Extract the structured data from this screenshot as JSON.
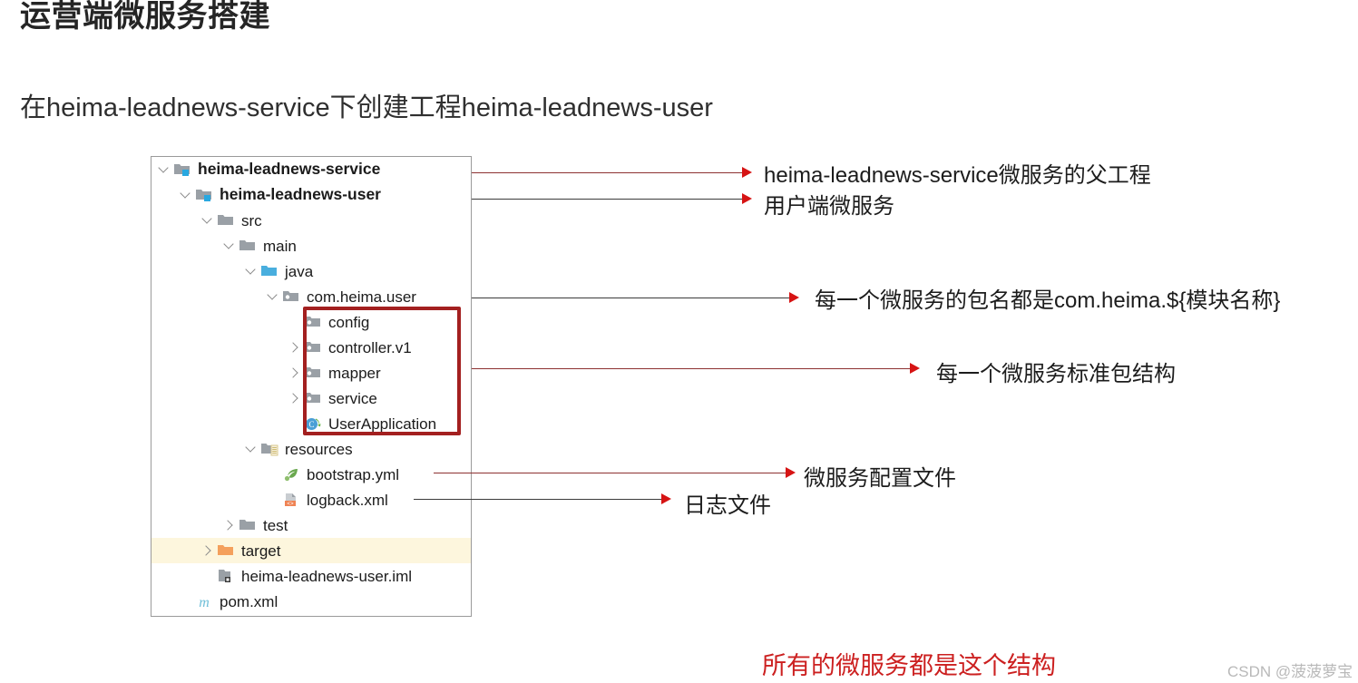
{
  "page": {
    "title": "运营端微服务搭建",
    "subtitle": "在heima-leadnews-service下创建工程heima-leadnews-user",
    "bottom_note": "所有的微服务都是这个结构",
    "watermark": "CSDN @菠菠萝宝"
  },
  "colors": {
    "red_box_border": "#a32020",
    "arrow_head": "#d61414",
    "arrow_line": "#8d3232",
    "arrow_line_dark": "#3b3b3b",
    "highlight_row": "#fdf6dd",
    "note_red": "#cc2020",
    "folder_gray": "#9aa0a6",
    "folder_blue": "#49aede",
    "folder_orange": "#f4a05c",
    "module_badge": "#29a8e0",
    "panel_border": "#9a9a9a"
  },
  "tree": {
    "rows": [
      {
        "label": "heima-leadnews-service",
        "icon": "module-folder-icon",
        "indent": 0,
        "chevron": "down",
        "bold": true,
        "highlight": false
      },
      {
        "label": "heima-leadnews-user",
        "icon": "module-folder-icon",
        "indent": 1,
        "chevron": "down",
        "bold": true,
        "highlight": false
      },
      {
        "label": "src",
        "icon": "folder-gray-icon",
        "indent": 2,
        "chevron": "down",
        "bold": false,
        "highlight": false
      },
      {
        "label": "main",
        "icon": "folder-gray-icon",
        "indent": 3,
        "chevron": "down",
        "bold": false,
        "highlight": false
      },
      {
        "label": "java",
        "icon": "folder-blue-icon",
        "indent": 4,
        "chevron": "down",
        "bold": false,
        "highlight": false
      },
      {
        "label": "com.heima.user",
        "icon": "package-icon",
        "indent": 5,
        "chevron": "down",
        "bold": false,
        "highlight": false
      },
      {
        "label": "config",
        "icon": "package-icon",
        "indent": 6,
        "chevron": "none",
        "bold": false,
        "highlight": false
      },
      {
        "label": "controller.v1",
        "icon": "package-icon",
        "indent": 6,
        "chevron": "right",
        "bold": false,
        "highlight": false
      },
      {
        "label": "mapper",
        "icon": "package-icon",
        "indent": 6,
        "chevron": "right",
        "bold": false,
        "highlight": false
      },
      {
        "label": "service",
        "icon": "package-icon",
        "indent": 6,
        "chevron": "right",
        "bold": false,
        "highlight": false
      },
      {
        "label": "UserApplication",
        "icon": "spring-class-icon",
        "indent": 6,
        "chevron": "none",
        "bold": false,
        "highlight": false
      },
      {
        "label": "resources",
        "icon": "resources-folder-icon",
        "indent": 4,
        "chevron": "down",
        "bold": false,
        "highlight": false
      },
      {
        "label": "bootstrap.yml",
        "icon": "yaml-leaf-icon",
        "indent": 5,
        "chevron": "none",
        "bold": false,
        "highlight": false
      },
      {
        "label": "logback.xml",
        "icon": "xml-file-icon",
        "indent": 5,
        "chevron": "none",
        "bold": false,
        "highlight": false
      },
      {
        "label": "test",
        "icon": "folder-gray-icon",
        "indent": 3,
        "chevron": "right",
        "bold": false,
        "highlight": false
      },
      {
        "label": "target",
        "icon": "folder-orange-icon",
        "indent": 2,
        "chevron": "right",
        "bold": false,
        "highlight": true
      },
      {
        "label": "heima-leadnews-user.iml",
        "icon": "iml-module-icon",
        "indent": 2,
        "chevron": "none",
        "bold": false,
        "highlight": false
      },
      {
        "label": "pom.xml",
        "icon": "maven-icon",
        "indent": 1,
        "chevron": "none",
        "bold": false,
        "highlight": false
      }
    ]
  },
  "annotations": [
    {
      "id": "a1",
      "text": "heima-leadnews-service微服务的父工程"
    },
    {
      "id": "a2",
      "text": "用户端微服务"
    },
    {
      "id": "a3",
      "text": "每一个微服务的包名都是com.heima.${模块名称}"
    },
    {
      "id": "a4",
      "text": "每一个微服务标准包结构"
    },
    {
      "id": "a5",
      "text": "微服务配置文件"
    },
    {
      "id": "a6",
      "text": "日志文件"
    }
  ]
}
